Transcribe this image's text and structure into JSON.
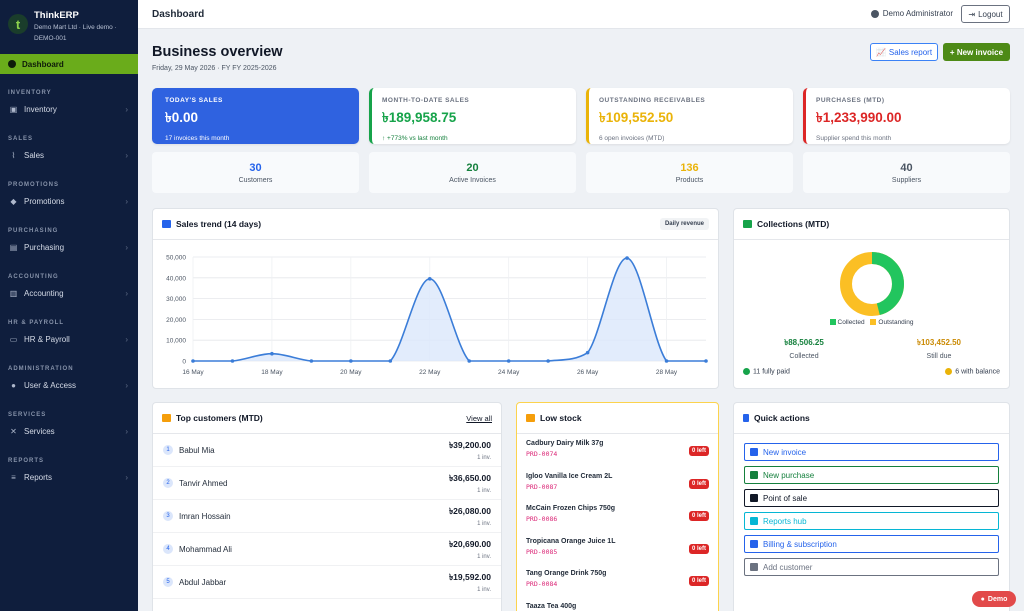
{
  "brand": {
    "name": "ThinkERP",
    "sub1": "Demo Mart Ltd · Live demo ·",
    "sub2": "DEMO-001"
  },
  "sidebar": {
    "active": "Dashboard",
    "sections": [
      {
        "title": "INVENTORY",
        "item": "Inventory",
        "icon": "box-icon"
      },
      {
        "title": "SALES",
        "item": "Sales",
        "icon": "chart-icon"
      },
      {
        "title": "PROMOTIONS",
        "item": "Promotions",
        "icon": "tag-icon"
      },
      {
        "title": "PURCHASING",
        "item": "Purchasing",
        "icon": "cart-icon"
      },
      {
        "title": "ACCOUNTING",
        "item": "Accounting",
        "icon": "bank-icon"
      },
      {
        "title": "HR & PAYROLL",
        "item": "HR & Payroll",
        "icon": "wallet-icon"
      },
      {
        "title": "ADMINISTRATION",
        "item": "User & Access",
        "icon": "users-icon"
      },
      {
        "title": "SERVICES",
        "item": "Services",
        "icon": "tools-icon"
      },
      {
        "title": "REPORTS",
        "item": "Reports",
        "icon": "report-icon"
      }
    ]
  },
  "topbar": {
    "title": "Dashboard",
    "user": "Demo Administrator",
    "logout": "Logout"
  },
  "overview": {
    "title": "Business overview",
    "date": "Friday, 29 May 2026 · FY FY 2025-2026",
    "sales_report": "Sales report",
    "new_invoice": "+ New invoice"
  },
  "kpis": [
    {
      "label": "TODAY'S SALES",
      "value": "৳0.00",
      "sub": "17 invoices this month",
      "color": "#2f62e0"
    },
    {
      "label": "MONTH-TO-DATE SALES",
      "value": "৳189,958.75",
      "sub": "↑ +773% vs last month",
      "color": "#16a34a"
    },
    {
      "label": "OUTSTANDING RECEIVABLES",
      "value": "৳109,552.50",
      "sub": "6 open invoices (MTD)",
      "color": "#eab308"
    },
    {
      "label": "PURCHASES (MTD)",
      "value": "৳1,233,990.00",
      "sub": "Supplier spend this month",
      "color": "#dc2626"
    }
  ],
  "stats": [
    {
      "value": "30",
      "label": "Customers",
      "color": "#2563eb"
    },
    {
      "value": "20",
      "label": "Active Invoices",
      "color": "#15803d"
    },
    {
      "value": "136",
      "label": "Products",
      "color": "#eab308"
    },
    {
      "value": "40",
      "label": "Suppliers",
      "color": "#4b5563"
    }
  ],
  "trend": {
    "title": "Sales trend (14 days)",
    "badge": "Daily revenue"
  },
  "chart_data": {
    "type": "area",
    "title": "Sales trend (14 days)",
    "x": [
      "16 May",
      "17 May",
      "18 May",
      "19 May",
      "20 May",
      "21 May",
      "22 May",
      "23 May",
      "24 May",
      "25 May",
      "26 May",
      "27 May",
      "28 May",
      "29 May"
    ],
    "xticks": [
      "16 May",
      "18 May",
      "20 May",
      "22 May",
      "24 May",
      "26 May",
      "28 May"
    ],
    "series": [
      {
        "name": "Daily revenue",
        "values": [
          0,
          0,
          3500,
          0,
          0,
          0,
          39500,
          0,
          0,
          0,
          4000,
          49500,
          0,
          0
        ]
      }
    ],
    "ylim": [
      0,
      50000
    ],
    "yticks": [
      "0",
      "10,000",
      "20,000",
      "30,000",
      "40,000",
      "50,000"
    ],
    "grid": true
  },
  "collections": {
    "title": "Collections (MTD)",
    "collected_label": "Collected",
    "outstanding_label": "Outstanding",
    "collected_value": "৳88,506.25",
    "collected_caption": "Collected",
    "due_value": "৳103,452.50",
    "due_caption": "Still due",
    "paid": "11 fully paid",
    "balance": "6 with balance",
    "collected_share": 0.46
  },
  "top_customers": {
    "title": "Top customers (MTD)",
    "view_all": "View all",
    "rows": [
      {
        "rank": "1",
        "name": "Babul Mia",
        "amount": "৳39,200.00",
        "inv": "1 inv."
      },
      {
        "rank": "2",
        "name": "Tanvir Ahmed",
        "amount": "৳36,650.00",
        "inv": "1 inv."
      },
      {
        "rank": "3",
        "name": "Imran Hossain",
        "amount": "৳26,080.00",
        "inv": "1 inv."
      },
      {
        "rank": "4",
        "name": "Mohammad Ali",
        "amount": "৳20,690.00",
        "inv": "1 inv."
      },
      {
        "rank": "5",
        "name": "Abdul Jabbar",
        "amount": "৳19,592.00",
        "inv": "1 inv."
      }
    ]
  },
  "low_stock": {
    "title": "Low stock",
    "rows": [
      {
        "name": "Cadbury Dairy Milk 37g",
        "code": "PRD-0074",
        "badge": "0 left"
      },
      {
        "name": "Igloo Vanilla Ice Cream 2L",
        "code": "PRD-0087",
        "badge": "0 left"
      },
      {
        "name": "McCain Frozen Chips 750g",
        "code": "PRD-0086",
        "badge": "0 left"
      },
      {
        "name": "Tropicana Orange Juice 1L",
        "code": "PRD-0085",
        "badge": "0 left"
      },
      {
        "name": "Tang Orange Drink 750g",
        "code": "PRD-0084",
        "badge": "0 left"
      },
      {
        "name": "Taaza Tea 400g",
        "code": "",
        "badge": ""
      }
    ]
  },
  "quick_actions": {
    "title": "Quick actions",
    "items": [
      {
        "label": "New invoice",
        "color": "#2563eb"
      },
      {
        "label": "New purchase",
        "color": "#15803d"
      },
      {
        "label": "Point of sale",
        "color": "#111827"
      },
      {
        "label": "Reports hub",
        "color": "#06b6d4"
      },
      {
        "label": "Billing & subscription",
        "color": "#2563eb"
      },
      {
        "label": "Add customer",
        "color": "#6b7280"
      }
    ]
  },
  "demo_badge": "Demo"
}
